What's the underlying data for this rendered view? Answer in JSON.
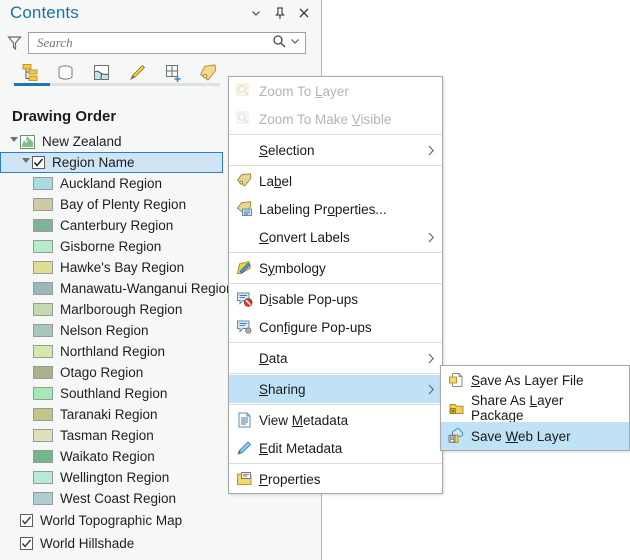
{
  "pane": {
    "title": "Contents",
    "header_buttons": [
      {
        "name": "chevron-down-icon",
        "tip": "Menu"
      },
      {
        "name": "pin-icon",
        "tip": "Auto Hide"
      },
      {
        "name": "close-icon",
        "tip": "Close"
      }
    ],
    "search": {
      "placeholder": "Search",
      "value": "",
      "filter_icon": "filter-icon",
      "search_icon": "search-icon",
      "dropdown_icon": "chevron-down-icon"
    },
    "toolbar": [
      {
        "name": "list-by-drawing-order-icon",
        "active": true
      },
      {
        "name": "list-by-data-source-icon",
        "active": false
      },
      {
        "name": "list-by-selection-icon",
        "active": false
      },
      {
        "name": "list-by-editing-icon",
        "active": false
      },
      {
        "name": "list-by-snapping-icon",
        "active": false
      },
      {
        "name": "list-by-labeling-icon",
        "active": false
      }
    ],
    "section_title": "Drawing Order",
    "map_node": {
      "label": "New Zealand",
      "expanded": true
    },
    "layer_node": {
      "label": "Region Name",
      "checked": true,
      "expanded": true,
      "selected": true
    },
    "legend_items": [
      {
        "label": "Auckland Region",
        "color": "#a9dce2"
      },
      {
        "label": "Bay of Plenty Region",
        "color": "#cdcba4"
      },
      {
        "label": "Canterbury Region",
        "color": "#7cb494"
      },
      {
        "label": "Gisborne Region",
        "color": "#b5ecca"
      },
      {
        "label": "Hawke's Bay Region",
        "color": "#e0dd97"
      },
      {
        "label": "Manawatu-Wanganui Region",
        "color": "#9cb7b7"
      },
      {
        "label": "Marlborough Region",
        "color": "#c5d8b0"
      },
      {
        "label": "Nelson Region",
        "color": "#a6c7bc"
      },
      {
        "label": "Northland Region",
        "color": "#d4e8a8"
      },
      {
        "label": "Otago Region",
        "color": "#a9b28b"
      },
      {
        "label": "Southland Region",
        "color": "#a4e8b4"
      },
      {
        "label": "Taranaki Region",
        "color": "#c2c48a"
      },
      {
        "label": "Tasman Region",
        "color": "#e0e0bb"
      },
      {
        "label": "Waikato Region",
        "color": "#72b887"
      },
      {
        "label": "Wellington Region",
        "color": "#b9e9d8"
      },
      {
        "label": "West Coast Region",
        "color": "#aecdd2"
      }
    ],
    "basemap_items": [
      {
        "label": "World Topographic Map",
        "checked": true
      },
      {
        "label": "World Hillshade",
        "checked": true
      }
    ]
  },
  "context_menu": {
    "items": [
      {
        "id": "zoom-to-layer",
        "label": "Zoom To Layer",
        "accel": "L",
        "icon": "zoom-to-layer-icon",
        "disabled": true,
        "arrow": false
      },
      {
        "id": "zoom-to-make-visible",
        "label": "Zoom To Make Visible",
        "accel": "V",
        "icon": "zoom-to-make-visible-icon",
        "disabled": true,
        "arrow": false
      },
      {
        "id": "sep1",
        "separator": true
      },
      {
        "id": "selection",
        "label": "Selection",
        "accel": "S",
        "icon": null,
        "disabled": false,
        "arrow": true
      },
      {
        "id": "sep2",
        "separator": true
      },
      {
        "id": "label",
        "label": "Label",
        "accel": "b",
        "icon": "label-icon",
        "disabled": false,
        "arrow": false
      },
      {
        "id": "labeling-properties",
        "label": "Labeling Properties...",
        "accel": "o",
        "icon": "labeling-properties-icon",
        "disabled": false,
        "arrow": false
      },
      {
        "id": "convert-labels",
        "label": "Convert Labels",
        "accel": "C",
        "icon": null,
        "disabled": false,
        "arrow": true
      },
      {
        "id": "sep3",
        "separator": true
      },
      {
        "id": "symbology",
        "label": "Symbology",
        "accel": "y",
        "icon": "symbology-icon",
        "disabled": false,
        "arrow": false
      },
      {
        "id": "sep4",
        "separator": true
      },
      {
        "id": "disable-pop-ups",
        "label": "Disable Pop-ups",
        "accel": "i",
        "icon": "disable-popups-icon",
        "disabled": false,
        "arrow": false
      },
      {
        "id": "configure-pop-ups",
        "label": "Configure Pop-ups",
        "accel": "f",
        "icon": "configure-popups-icon",
        "disabled": false,
        "arrow": false
      },
      {
        "id": "sep5",
        "separator": true
      },
      {
        "id": "data",
        "label": "Data",
        "accel": "D",
        "icon": null,
        "disabled": false,
        "arrow": true
      },
      {
        "id": "sep6",
        "separator": true
      },
      {
        "id": "sharing",
        "label": "Sharing",
        "accel": "S",
        "icon": null,
        "disabled": false,
        "arrow": true,
        "highlighted": true
      },
      {
        "id": "sep7",
        "separator": true
      },
      {
        "id": "view-metadata",
        "label": "View Metadata",
        "accel": "M",
        "icon": "view-metadata-icon",
        "disabled": false,
        "arrow": false
      },
      {
        "id": "edit-metadata",
        "label": "Edit Metadata",
        "accel": "E",
        "icon": "edit-metadata-icon",
        "disabled": false,
        "arrow": false
      },
      {
        "id": "sep8",
        "separator": true
      },
      {
        "id": "properties",
        "label": "Properties",
        "accel": "P",
        "icon": "properties-icon",
        "disabled": false,
        "arrow": false
      }
    ]
  },
  "sub_menu": {
    "items": [
      {
        "id": "save-as-layer-file",
        "label": "Save As Layer File",
        "accel": "S",
        "icon": "save-as-layer-file-icon",
        "highlighted": false
      },
      {
        "id": "share-as-layer-package",
        "label": "Share As Layer Package",
        "accel": "L",
        "icon": "share-as-layer-package-icon",
        "highlighted": false
      },
      {
        "id": "save-web-layer",
        "label": "Save Web Layer",
        "accel": "W",
        "icon": "save-web-layer-icon",
        "highlighted": true
      }
    ]
  },
  "colors": {
    "accent": "#1a6fa8",
    "selection": "#cfe4f5",
    "menu_highlight": "#bfe2f7",
    "pane_bg": "#f6f8f7"
  }
}
